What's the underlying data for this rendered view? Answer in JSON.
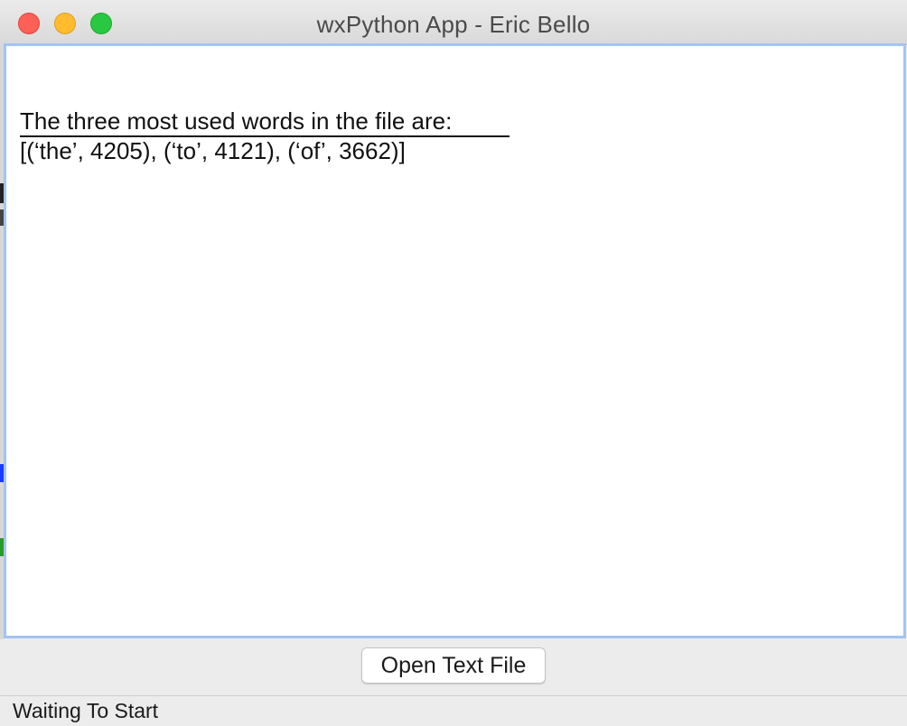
{
  "window": {
    "title": "wxPython App - Eric Bello"
  },
  "text_output": {
    "separator": "________________________________________",
    "heading": "The three most used words in the file are:",
    "result": "[(‘the’, 4205), (‘to’, 4121), (‘of’, 3662)]"
  },
  "toolbar": {
    "open_button_label": "Open Text File"
  },
  "status": {
    "text": "Waiting To Start"
  }
}
